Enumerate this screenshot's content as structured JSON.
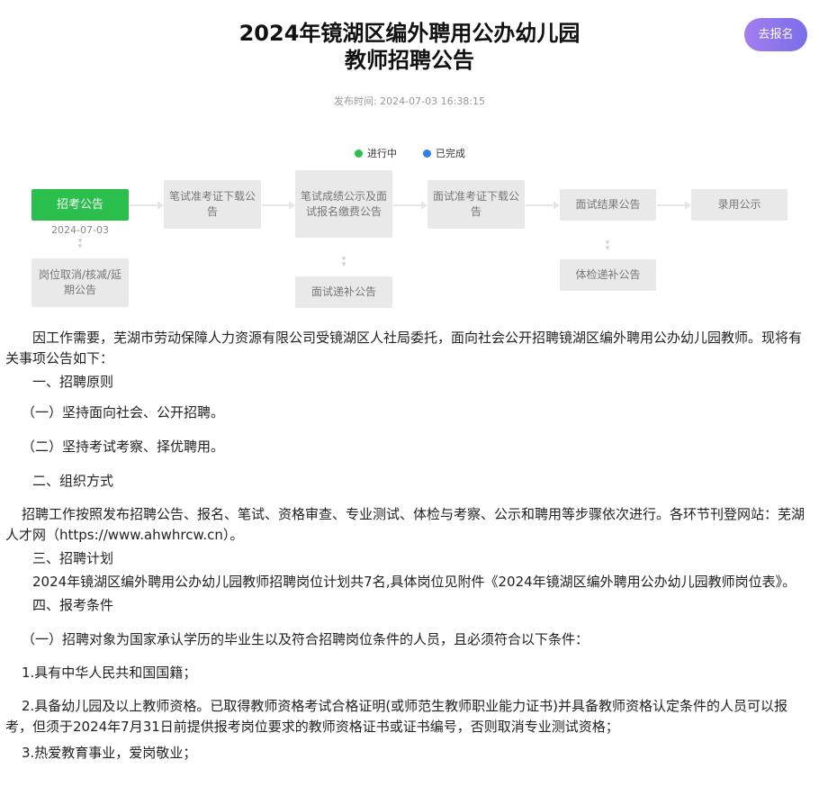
{
  "header": {
    "title_line1": "2024年镜湖区编外聘用公办幼儿园",
    "title_line2": "教师招聘公告",
    "apply_label": "去报名",
    "publish_time": "发布时间: 2024-07-03 16:38:15"
  },
  "legend": {
    "in_progress": "进行中",
    "completed": "已完成",
    "in_progress_color": "#2bbf4e",
    "completed_color": "#2f7fe8"
  },
  "steps": {
    "s1": "招考公告",
    "s1_date": "2024-07-03",
    "s2": "笔试准考证下载公告",
    "s3": "笔试成绩公示及面试报名缴费公告",
    "s4": "面试准考证下载公告",
    "s5": "面试结果公告",
    "s6": "录用公示",
    "sub1": "岗位取消/核减/延期公告",
    "sub3": "面试递补公告",
    "sub5": "体检递补公告"
  },
  "article": {
    "p1": "因工作需要，芜湖市劳动保障人力资源有限公司受镜湖区人社局委托，面向社会公开招聘镜湖区编外聘用公办幼儿园教师。现将有关事项公告如下：",
    "h1": "一、招聘原则",
    "p2": "（一）坚持面向社会、公开招聘。",
    "p3": "（二）坚持考试考察、择优聘用。",
    "h2": "二、组织方式",
    "p4": "招聘工作按照发布招聘公告、报名、笔试、资格审查、专业测试、体检与考察、公示和聘用等步骤依次进行。各环节刊登网站：芜湖人才网（https://www.ahwhrcw.cn）。",
    "h3": "三、招聘计划",
    "p5": "2024年镜湖区编外聘用公办幼儿园教师招聘岗位计划共7名,具体岗位见附件《2024年镜湖区编外聘用公办幼儿园教师岗位表》。",
    "h4": "四、报考条件",
    "p6": "（一）招聘对象为国家承认学历的毕业生以及符合招聘岗位条件的人员，且必须符合以下条件：",
    "p7": "1.具有中华人民共和国国籍；",
    "p8": "2.具备幼儿园及以上教师资格。已取得教师资格考试合格证明(或师范生教师职业能力证书)并具备教师资格认定条件的人员可以报考，但须于2024年7月31日前提供报考岗位要求的教师资格证书或证书编号，否则取消专业测试资格；",
    "p9": "3.热爱教育事业，爱岗敬业；"
  }
}
